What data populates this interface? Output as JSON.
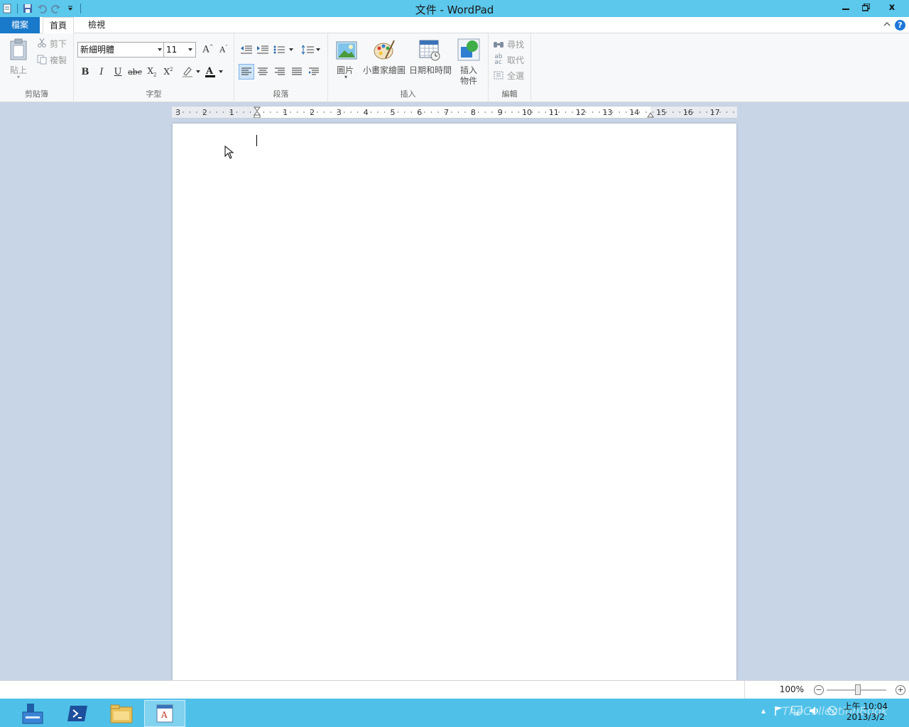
{
  "window": {
    "title": "文件 - WordPad"
  },
  "window_controls": {
    "minimize": "–",
    "restore": "❏",
    "close": "x"
  },
  "tabs": {
    "file": "檔案",
    "home": "首頁",
    "view": "檢視"
  },
  "ribbon": {
    "clipboard": {
      "paste": "貼上",
      "cut": "剪下",
      "copy": "複製",
      "label": "剪貼簿"
    },
    "font": {
      "family": "新細明體",
      "size": "11",
      "bold": "B",
      "italic": "I",
      "underline": "U",
      "strikethrough": "abc",
      "label": "字型"
    },
    "paragraph": {
      "label": "段落"
    },
    "insert": {
      "picture": "圖片",
      "paint_drawing": "小畫家繪圖",
      "date_time": "日期和時間",
      "insert_object_line1": "插入",
      "insert_object_line2": "物件",
      "label": "插入"
    },
    "editing": {
      "find": "尋找",
      "replace": "取代",
      "select_all": "全選",
      "label": "編輯"
    }
  },
  "ruler": {
    "ticks": [
      "3",
      "2",
      "1",
      "1",
      "2",
      "3",
      "4",
      "5",
      "6",
      "7",
      "8",
      "9",
      "10",
      "11",
      "12",
      "13",
      "14",
      "15",
      "16",
      "17"
    ]
  },
  "status": {
    "zoom": "100%"
  },
  "taskbar": {
    "clock_time": "上午 10:04",
    "clock_date": "2013/3/2",
    "watermark": "TheCollectionBook"
  },
  "colors": {
    "titlebar": "#5bc8ec",
    "file_tab": "#1979ca",
    "taskbar": "#4fc1e9",
    "workspace": "#c8d5e7"
  }
}
